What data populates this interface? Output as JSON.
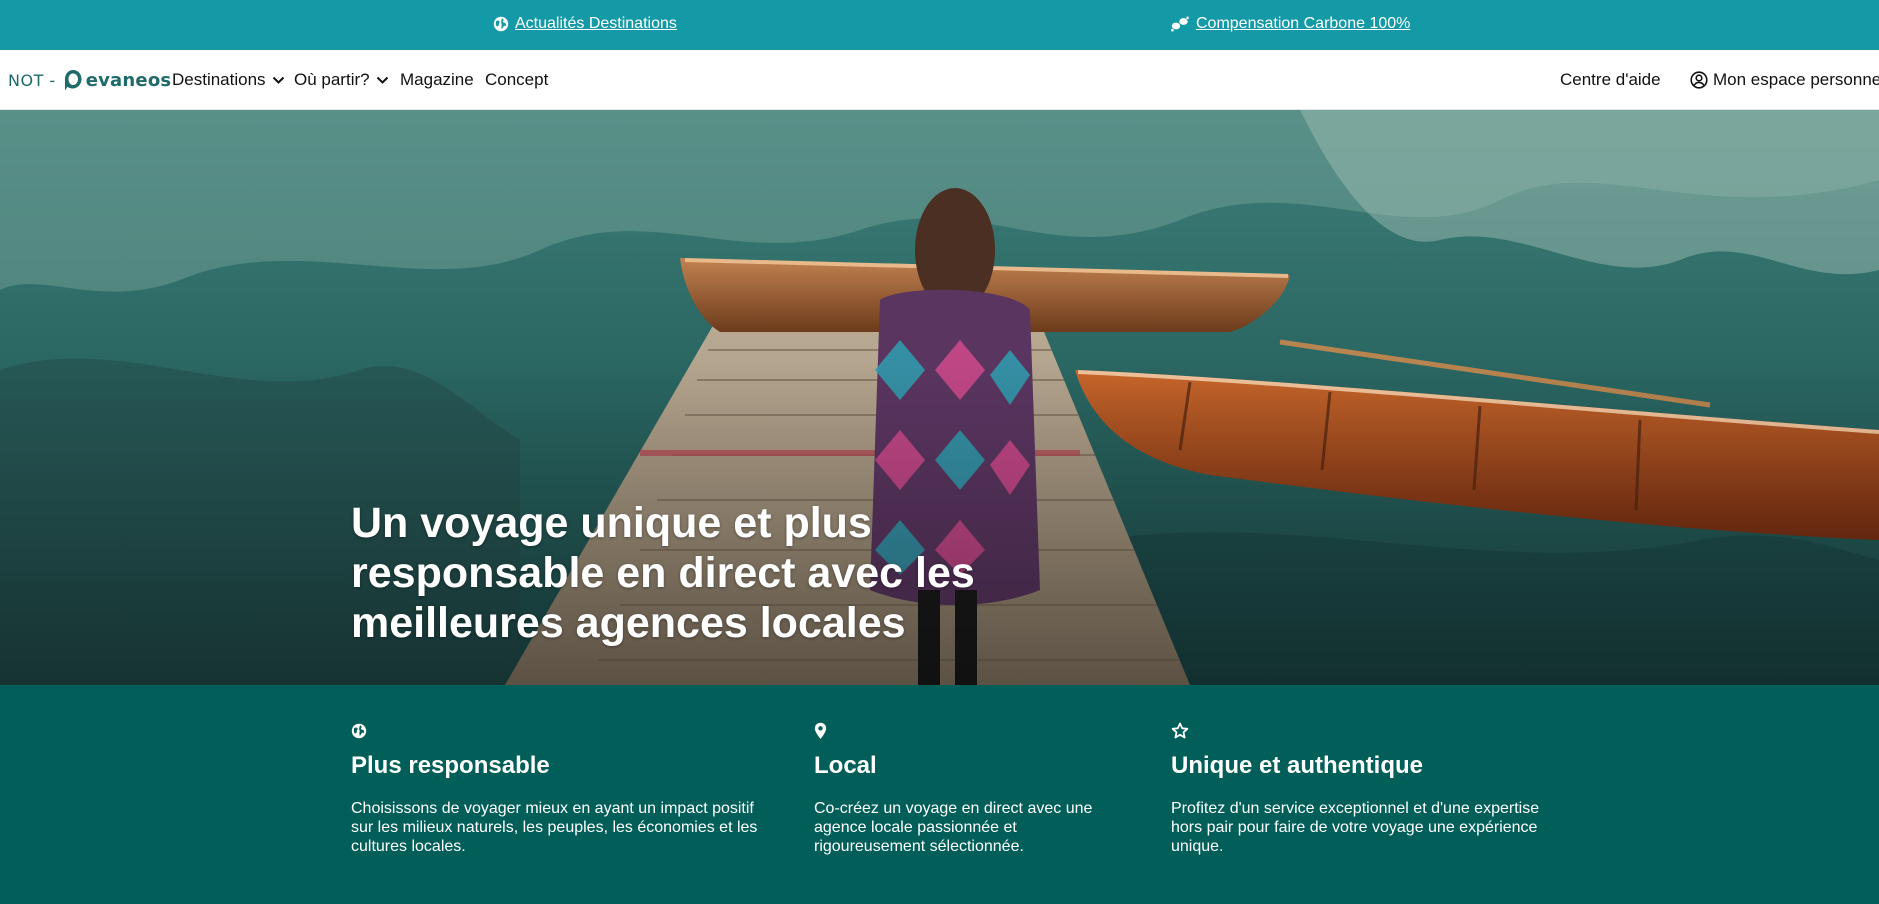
{
  "top_banner": {
    "news_link": "Actualités Destinations",
    "carbon_link": "Compensation Carbone 100%",
    "background_color": "#1499a6"
  },
  "navbar": {
    "logo_prefix": "NOT -",
    "logo_word": "evaneos",
    "items": [
      {
        "label": "Destinations",
        "has_dropdown": true
      },
      {
        "label": "Où partir?",
        "has_dropdown": true
      },
      {
        "label": "Magazine",
        "has_dropdown": false
      },
      {
        "label": "Concept",
        "has_dropdown": false
      }
    ],
    "help_label": "Centre d'aide",
    "account_label": "Mon espace personnel",
    "brand_color": "#1f6b6b"
  },
  "hero": {
    "title": "Un voyage unique et plus responsable en direct avec les meilleures agences locales"
  },
  "features": {
    "background_color": "#025e58",
    "items": [
      {
        "icon": "globe-icon",
        "title": "Plus responsable",
        "text": "Choisissons de voyager mieux en ayant un impact positif sur les milieux naturels, les peuples, les économies et les cultures locales."
      },
      {
        "icon": "map-pin-icon",
        "title": "Local",
        "text": "Co-créez un voyage en direct avec une agence locale passionnée et rigoureusement sélectionnée."
      },
      {
        "icon": "star-icon",
        "title": "Unique et authentique",
        "text": "Profitez d'un service exceptionnel et d'une expertise hors pair pour faire de votre voyage une expérience unique."
      }
    ]
  }
}
